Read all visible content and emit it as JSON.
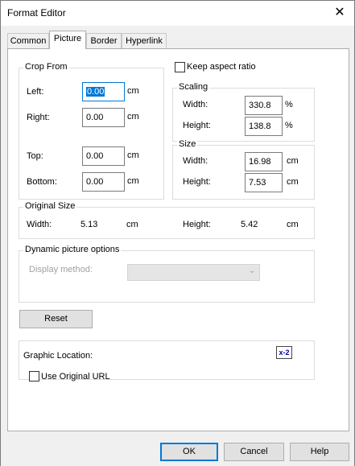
{
  "window": {
    "title": "Format Editor"
  },
  "tabs": [
    "Common",
    "Picture",
    "Border",
    "Hyperlink"
  ],
  "crop": {
    "title": "Crop From",
    "left_label": "Left:",
    "left_value": "0.00",
    "right_label": "Right:",
    "right_value": "0.00",
    "top_label": "Top:",
    "top_value": "0.00",
    "bottom_label": "Bottom:",
    "bottom_value": "0.00",
    "unit": "cm"
  },
  "keep_aspect_label": "Keep aspect ratio",
  "scaling": {
    "title": "Scaling",
    "width_label": "Width:",
    "width_value": "330.8",
    "height_label": "Height:",
    "height_value": "138.8",
    "unit": "%"
  },
  "size": {
    "title": "Size",
    "width_label": "Width:",
    "width_value": "16.98",
    "height_label": "Height:",
    "height_value": "7.53",
    "unit": "cm"
  },
  "original_size": {
    "title": "Original Size",
    "width_label": "Width:",
    "width_value": "5.13",
    "height_label": "Height:",
    "height_value": "5.42",
    "unit": "cm"
  },
  "dynamic": {
    "title": "Dynamic picture options",
    "display_method_label": "Display method:",
    "display_method_value": ""
  },
  "reset_label": "Reset",
  "graphic_location_label": "Graphic Location:",
  "graphic_icon_text": "x-2",
  "use_original_url_label": "Use Original URL",
  "buttons": {
    "ok": "OK",
    "cancel": "Cancel",
    "help": "Help"
  }
}
